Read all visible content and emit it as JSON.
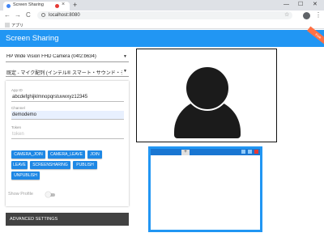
{
  "browser": {
    "tab_title": "Screen Sharing",
    "tab_close": "×",
    "new_tab": "+",
    "min": "—",
    "max": "☐",
    "close": "✕",
    "back": "←",
    "forward": "→",
    "reload": "C",
    "url": "localhost:8080",
    "star": "☆",
    "menu": "⋮",
    "bookmark_apps": "アプリ"
  },
  "app": {
    "title": "Screen Sharing",
    "ribbon": "Fork",
    "camera_select": "HP Wide Vision FHD Camera (04f2:b634)",
    "mic_select": "既定 - マイク配列 (インテル® スマート・サウンド・テクノロジー)",
    "fields": {
      "appid_label": "App ID",
      "appid_value": "abcdefghijklmnopqrstuvwxyz12345",
      "channel_label": "Channel",
      "channel_value": "demodemo",
      "token_label": "Token",
      "token_placeholder": "token"
    },
    "buttons": {
      "camera_join": "CAMERA_JOIN",
      "camera_leave": "CAMERA_LEAVE",
      "join": "JOIN",
      "leave": "LEAVE",
      "screensharing": "SCREENSHARING",
      "publish": "PUBLISH",
      "unpublish": "UNPUBLISH"
    },
    "show_profile": "Show Profile",
    "show_profile_on": false,
    "advanced_settings": "ADVANCED SETTINGS",
    "screen_tab_plus": "+"
  },
  "colors": {
    "primary": "#2196f3",
    "button": "#1e88e5",
    "dark_bar": "#424242"
  }
}
